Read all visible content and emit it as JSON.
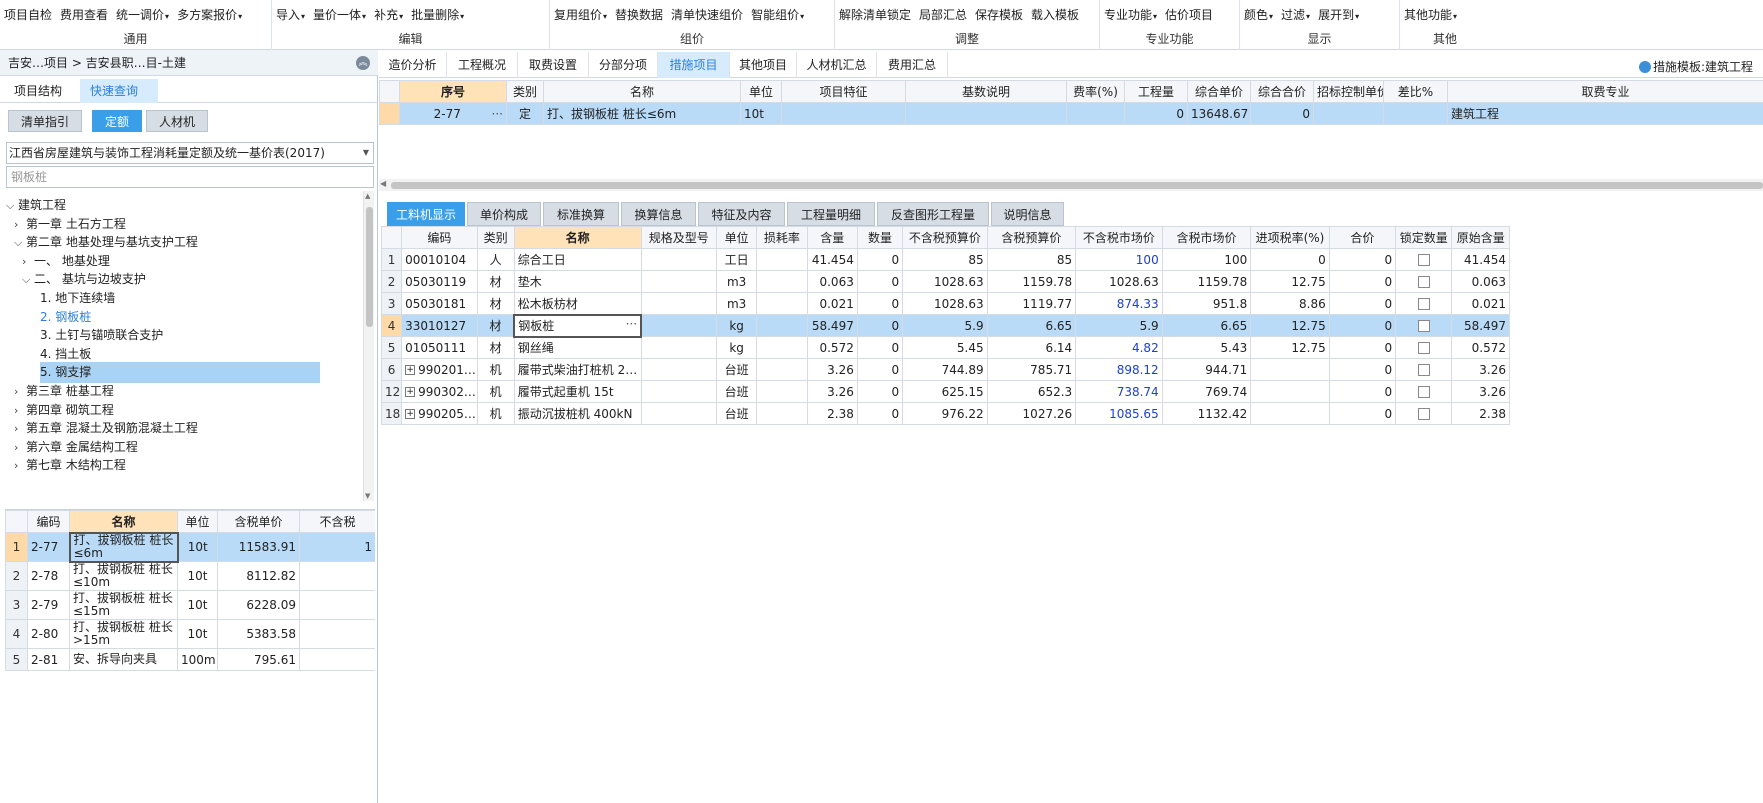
{
  "ribbon": {
    "groups": [
      {
        "label": "通用",
        "items": [
          "项目自检",
          "费用查看",
          "统一调价",
          "多方案报价"
        ],
        "dd": [
          false,
          false,
          true,
          true
        ]
      },
      {
        "label": "编辑",
        "items": [
          "导入",
          "量价一体",
          "补充",
          "批量删除"
        ],
        "dd": [
          true,
          true,
          true,
          true
        ]
      },
      {
        "label": "组价",
        "items": [
          "复用组价",
          "替换数据",
          "清单快速组价",
          "智能组价"
        ],
        "dd": [
          true,
          false,
          false,
          true
        ]
      },
      {
        "label": "调整",
        "items": [
          "解除清单锁定",
          "局部汇总",
          "保存模板",
          "载入模板"
        ],
        "dd": [
          false,
          false,
          false,
          false
        ]
      },
      {
        "label": "专业功能",
        "items": [
          "专业功能",
          "估价项目"
        ],
        "dd": [
          true,
          false
        ]
      },
      {
        "label": "显示",
        "items": [
          "颜色",
          "过滤",
          "展开到"
        ],
        "dd": [
          true,
          true,
          true
        ]
      },
      {
        "label": "其他",
        "items": [
          "其他功能"
        ],
        "dd": [
          true
        ]
      }
    ]
  },
  "left": {
    "breadcrumb": "吉安…项目 > 吉安县职…目-土建",
    "tabs": [
      "项目结构",
      "快速查询"
    ],
    "subtabs": [
      "清单指引",
      "定额",
      "人材机"
    ],
    "select": "江西省房屋建筑与装饰工程消耗量定额及统一基价表(2017)",
    "search_placeholder": "钢板桩",
    "tree": [
      {
        "label": "建筑工程",
        "caret": "down"
      },
      {
        "label": "第一章  土石方工程",
        "caret": "right"
      },
      {
        "label": "第二章  地基处理与基坑支护工程",
        "caret": "down"
      },
      {
        "label": "一、  地基处理",
        "caret": "right"
      },
      {
        "label": "二、  基坑与边坡支护",
        "caret": "down"
      },
      {
        "label": "1.  地下连续墙",
        "caret": ""
      },
      {
        "label": "2.  钢板桩",
        "caret": ""
      },
      {
        "label": "3.  土钉与锚喷联合支护",
        "caret": ""
      },
      {
        "label": "4.  挡土板",
        "caret": ""
      },
      {
        "label": "5.  钢支撑",
        "caret": ""
      },
      {
        "label": "第三章  桩基工程",
        "caret": "right"
      },
      {
        "label": "第四章  砌筑工程",
        "caret": "right"
      },
      {
        "label": "第五章  混凝土及钢筋混凝土工程",
        "caret": "right"
      },
      {
        "label": "第六章  金属结构工程",
        "caret": "right"
      },
      {
        "label": "第七章  木结构工程",
        "caret": "right"
      }
    ],
    "table": {
      "headers": [
        "编码",
        "名称",
        "单位",
        "含税单价",
        "不含税"
      ],
      "rows": [
        {
          "no": "1",
          "code": "2-77",
          "name": "打、拔钢板桩 桩长≤6m",
          "unit": "10t",
          "price": "11583.91",
          "ntax": "1"
        },
        {
          "no": "2",
          "code": "2-78",
          "name": "打、拔钢板桩 桩长≤10m",
          "unit": "10t",
          "price": "8112.82",
          "ntax": ""
        },
        {
          "no": "3",
          "code": "2-79",
          "name": "打、拔钢板桩 桩长≤15m",
          "unit": "10t",
          "price": "6228.09",
          "ntax": ""
        },
        {
          "no": "4",
          "code": "2-80",
          "name": "打、拔钢板桩 桩长>15m",
          "unit": "10t",
          "price": "5383.58",
          "ntax": ""
        },
        {
          "no": "5",
          "code": "2-81",
          "name": "安、拆导向夹具",
          "unit": "100m",
          "price": "795.61",
          "ntax": ""
        }
      ]
    }
  },
  "main": {
    "tabs": [
      "造价分析",
      "工程概况",
      "取费设置",
      "分部分项",
      "措施项目",
      "其他项目",
      "人材机汇总",
      "费用汇总"
    ],
    "template": "措施模板:建筑工程",
    "top_table": {
      "headers": [
        "序号",
        "类别",
        "名称",
        "单位",
        "项目特征",
        "基数说明",
        "费率(%)",
        "工程量",
        "综合单价",
        "综合合价",
        "招标控制单价",
        "差比%",
        "取费专业"
      ],
      "row": {
        "no": "2-77",
        "type": "定",
        "name": "打、拔钢板桩 桩长≤6m",
        "unit": "10t",
        "feature": "",
        "base": "",
        "rate": "",
        "qty": "0",
        "uprice": "13648.67",
        "total": "0",
        "ctrl": "",
        "diff": "",
        "spec": "建筑工程"
      }
    },
    "bottom_tabs": [
      "工料机显示",
      "单价构成",
      "标准换算",
      "换算信息",
      "特征及内容",
      "工程量明细",
      "反查图形工程量",
      "说明信息"
    ],
    "bottom_table": {
      "headers": [
        "编码",
        "类别",
        "名称",
        "规格及型号",
        "单位",
        "损耗率",
        "含量",
        "数量",
        "不含税预算价",
        "含税预算价",
        "不含税市场价",
        "含税市场价",
        "进项税率(%)",
        "合价",
        "锁定数量",
        "原始含量"
      ],
      "rows": [
        {
          "no": "1",
          "code": "00010104",
          "type": "人",
          "name": "综合工日",
          "spec": "",
          "unit": "工日",
          "loss": "",
          "content": "41.454",
          "qty": "0",
          "nb": "85",
          "tb": "85",
          "nm": "100",
          "tm": "100",
          "tax": "0",
          "total": "0",
          "orig": "41.454",
          "plus": false
        },
        {
          "no": "2",
          "code": "05030119",
          "type": "材",
          "name": "垫木",
          "spec": "",
          "unit": "m3",
          "loss": "",
          "content": "0.063",
          "qty": "0",
          "nb": "1028.63",
          "tb": "1159.78",
          "nm": "1028.63",
          "tm": "1159.78",
          "tax": "12.75",
          "total": "0",
          "orig": "0.063",
          "plus": false
        },
        {
          "no": "3",
          "code": "05030181",
          "type": "材",
          "name": "松木板枋材",
          "spec": "",
          "unit": "m3",
          "loss": "",
          "content": "0.021",
          "qty": "0",
          "nb": "1028.63",
          "tb": "1119.77",
          "nm": "874.33",
          "tm": "951.8",
          "tax": "8.86",
          "total": "0",
          "orig": "0.021",
          "plus": false
        },
        {
          "no": "4",
          "code": "33010127",
          "type": "材",
          "name": "钢板桩",
          "spec": "",
          "unit": "kg",
          "loss": "",
          "content": "58.497",
          "qty": "0",
          "nb": "5.9",
          "tb": "6.65",
          "nm": "5.9",
          "tm": "6.65",
          "tax": "12.75",
          "total": "0",
          "orig": "58.497",
          "plus": false
        },
        {
          "no": "5",
          "code": "01050111",
          "type": "材",
          "name": "钢丝绳",
          "spec": "",
          "unit": "kg",
          "loss": "",
          "content": "0.572",
          "qty": "0",
          "nb": "5.45",
          "tb": "6.14",
          "nm": "4.82",
          "tm": "5.43",
          "tax": "12.75",
          "total": "0",
          "orig": "0.572",
          "plus": false
        },
        {
          "no": "6",
          "code": "990201…",
          "type": "机",
          "name": "履带式柴油打桩机 2…",
          "spec": "",
          "unit": "台班",
          "loss": "",
          "content": "3.26",
          "qty": "0",
          "nb": "744.89",
          "tb": "785.71",
          "nm": "898.12",
          "tm": "944.71",
          "tax": "",
          "total": "0",
          "orig": "3.26",
          "plus": true
        },
        {
          "no": "12",
          "code": "990302…",
          "type": "机",
          "name": "履带式起重机 15t",
          "spec": "",
          "unit": "台班",
          "loss": "",
          "content": "3.26",
          "qty": "0",
          "nb": "625.15",
          "tb": "652.3",
          "nm": "738.74",
          "tm": "769.74",
          "tax": "",
          "total": "0",
          "orig": "3.26",
          "plus": true
        },
        {
          "no": "18",
          "code": "990205…",
          "type": "机",
          "name": "振动沉拔桩机 400kN",
          "spec": "",
          "unit": "台班",
          "loss": "",
          "content": "2.38",
          "qty": "0",
          "nb": "976.22",
          "tb": "1027.26",
          "nm": "1085.65",
          "tm": "1132.42",
          "tax": "",
          "total": "0",
          "orig": "2.38",
          "plus": true
        }
      ]
    }
  }
}
